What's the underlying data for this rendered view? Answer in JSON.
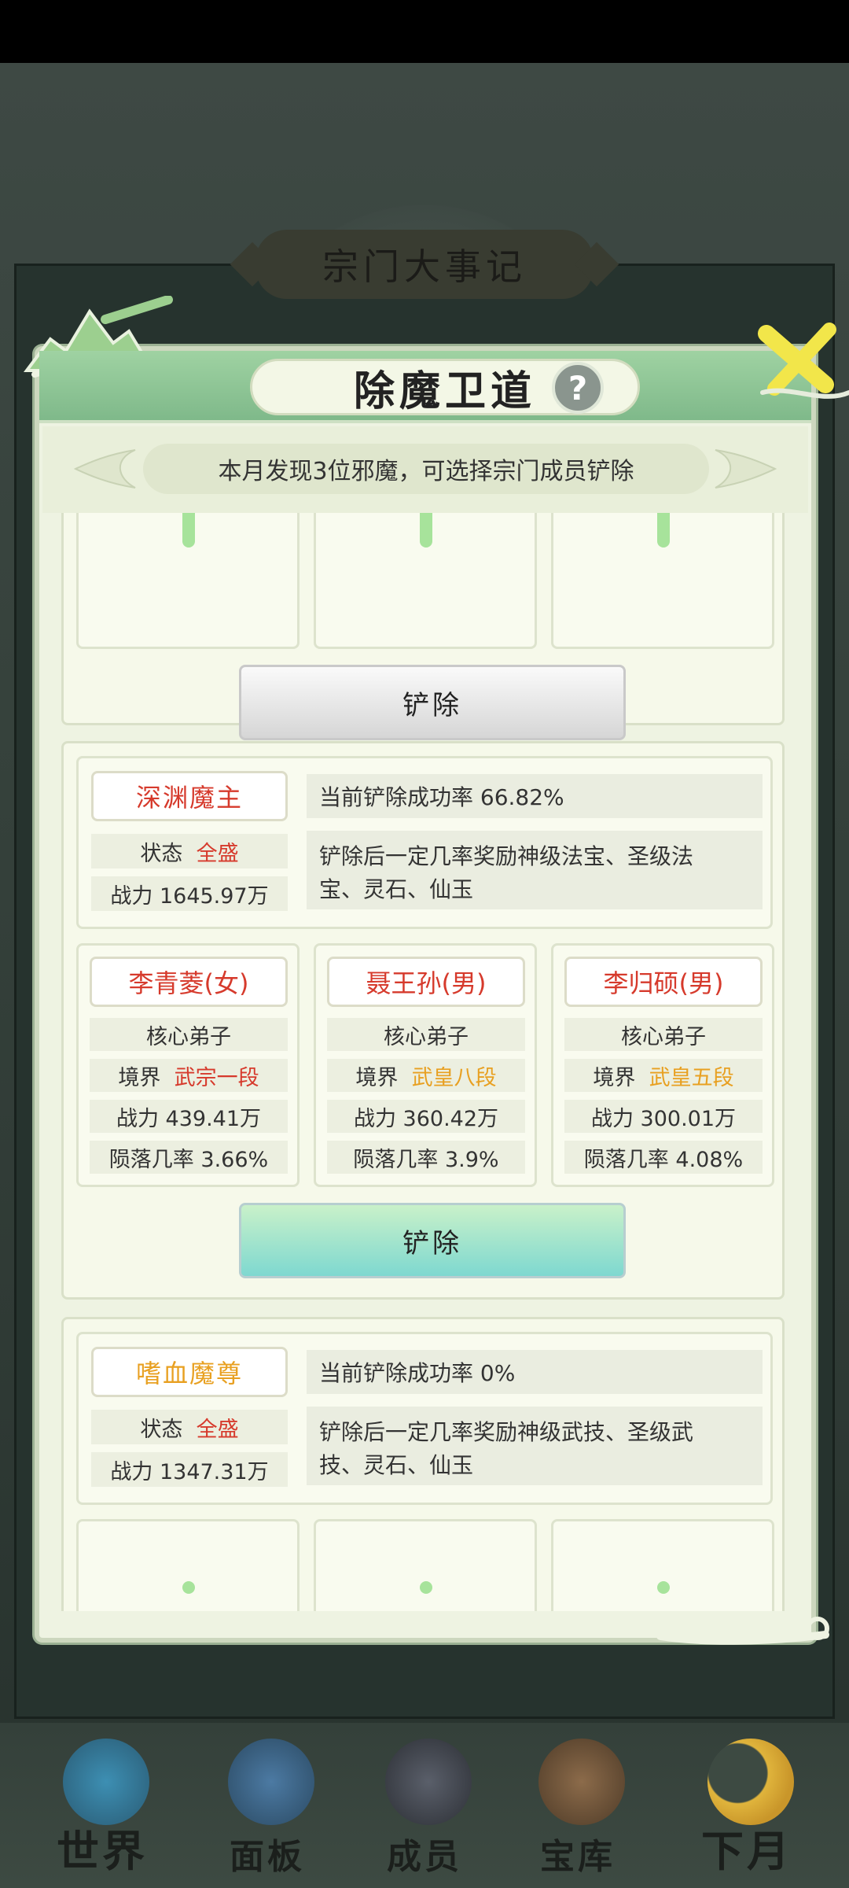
{
  "background": {
    "banner_title": "宗门大事记"
  },
  "modal": {
    "title": "除魔卫道",
    "help_label": "?",
    "notice": "本月发现3位邪魔，可选择宗门成员铲除"
  },
  "top_card": {
    "button_label": "铲除"
  },
  "demons": [
    {
      "name": "深渊魔主",
      "status_label": "状态",
      "status_value": "全盛",
      "power": "战力 1645.97万",
      "success_rate": "当前铲除成功率 66.82%",
      "reward_line1": "铲除后一定几率奖励神级法宝、圣级法",
      "reward_line2": "宝、灵石、仙玉",
      "button_label": "铲除",
      "members": [
        {
          "name": "李青菱(女)",
          "rank": "核心弟子",
          "realm_label": "境界",
          "realm_value": "武宗一段",
          "power": "战力 439.41万",
          "fall_rate": "陨落几率 3.66%"
        },
        {
          "name": "聂王孙(男)",
          "rank": "核心弟子",
          "realm_label": "境界",
          "realm_value": "武皇八段",
          "power": "战力 360.42万",
          "fall_rate": "陨落几率 3.9%"
        },
        {
          "name": "李归硕(男)",
          "rank": "核心弟子",
          "realm_label": "境界",
          "realm_value": "武皇五段",
          "power": "战力 300.01万",
          "fall_rate": "陨落几率 4.08%"
        }
      ]
    },
    {
      "name": "嗜血魔尊",
      "status_label": "状态",
      "status_value": "全盛",
      "power": "战力 1347.31万",
      "success_rate": "当前铲除成功率 0%",
      "reward_line1": "铲除后一定几率奖励神级武技、圣级武",
      "reward_line2": "技、灵石、仙玉"
    }
  ],
  "nav": [
    {
      "label": "世界",
      "icon": "world-pagoda-icon"
    },
    {
      "label": "面板",
      "icon": "panel-gate-icon"
    },
    {
      "label": "成员",
      "icon": "member-figure-icon"
    },
    {
      "label": "宝库",
      "icon": "treasury-temple-icon"
    },
    {
      "label": "下月",
      "icon": "next-month-moon-icon"
    }
  ],
  "colors": {
    "accent_green": "#8fc696",
    "red": "#d63a2c",
    "orange": "#e8a021",
    "purple": "#c12bd4"
  }
}
